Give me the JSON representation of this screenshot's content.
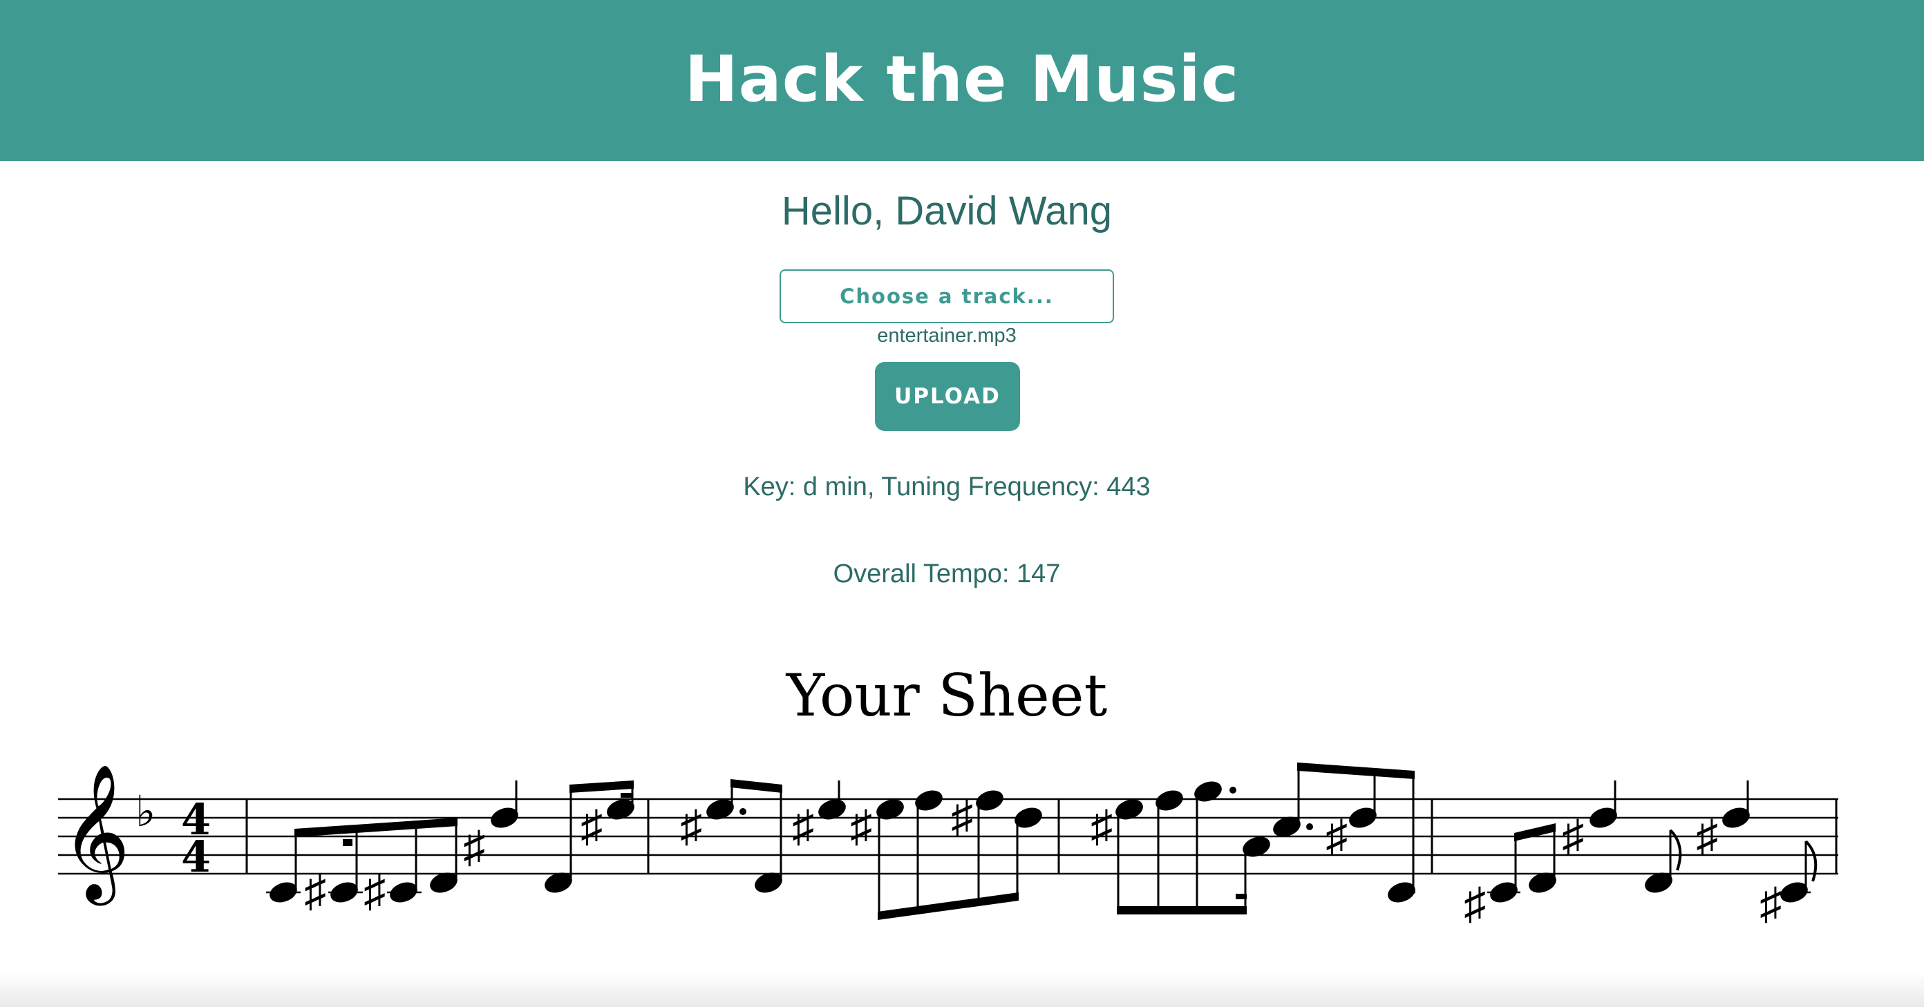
{
  "header": {
    "title": "Hack the Music"
  },
  "greeting": "Hello, David Wang",
  "upload": {
    "choose_label": "Choose a track...",
    "filename": "entertainer.mp3",
    "upload_label": "UPLOAD"
  },
  "analysis": {
    "key_line": "Key: d min, Tuning Frequency: 443",
    "tempo_line": "Overall Tempo: 147"
  },
  "sheet": {
    "title": "Your Sheet",
    "time_signature": {
      "top": "4",
      "bottom": "4"
    },
    "key_signature": "♭",
    "clef": "𝄞"
  },
  "colors": {
    "accent": "#3f9b91",
    "text": "#2d6b66"
  }
}
